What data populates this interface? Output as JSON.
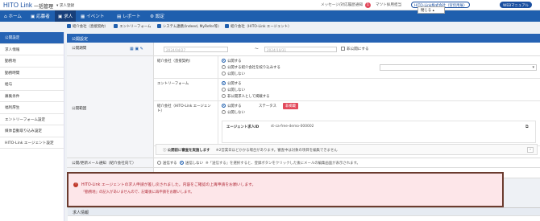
{
  "header": {
    "logo": "HITO Link",
    "app": "一括管理",
    "job": "▾ 求人登録",
    "message": "メッセージ/対応履歴",
    "notify": "通知",
    "notify_count": "1",
    "company": "マツト採用担当",
    "link1": "HITO-Link株式会社（宣伝用展）",
    "link2": "WEBマニュアル"
  },
  "nav": {
    "items": [
      "ホーム",
      "応募者",
      "求人",
      "イベント",
      "レポート",
      "設定"
    ],
    "active": "求人"
  },
  "tags": [
    "紹介会社（直接契約）",
    "エントリーフォーム",
    "システム連携(Indeed, MyRefer等)",
    "紹介会社（HITO-Link エージェント）"
  ],
  "sidebar": {
    "items": [
      "公開設定",
      "求人情報",
      "勤務地",
      "勤務時間",
      "給与",
      "募集条件",
      "福利厚生",
      "エントリーフォーム設定",
      "媒体自動取り込み設定",
      "HITO-Link エージェント設定"
    ]
  },
  "section": {
    "title": "公開設定"
  },
  "period": {
    "label": "公開期間",
    "start": "2024/04/27",
    "end": "2024/10/31",
    "sep": "〜",
    "checkbox": "非公開にする"
  },
  "scope": {
    "label": "公開範囲",
    "direct": {
      "label": "紹介会社（直接契約）",
      "options": [
        "公開する",
        "公開する紹介会社を絞り込みする",
        "公開しない"
      ]
    },
    "entry": {
      "label": "エントリーフォーム",
      "options": [
        "公開する",
        "公開しない",
        "非公開求人として掲載する"
      ]
    },
    "hito": {
      "label": "紹介会社（HITO-Link エージェント）",
      "options": [
        "公開する",
        "公開しない"
      ],
      "status_label": "ステータス",
      "status": "非掲載"
    },
    "agent_id_label": "エージェント求人ID",
    "agent_id": "st-ca-free-demo-000002",
    "notice": "公開前に審査を実施します",
    "notice_sub": "※2営業日ほどかかる場合があります。審査中は対象の項目を編集できません"
  },
  "mail": {
    "label": "公開/更新メール通知（紹介会社向て）",
    "opt1": "送信する",
    "opt2": "送信しない",
    "note": "※「送信する」を選択すると、登録ボタンをクリックした後にメールの編集画面が表示されます。"
  },
  "alert": {
    "title": "HITO-Link エージェントの求人申請が差し戻されました。内容をご確認の上再申請をお願いします。",
    "body": "「勤務地」の記入があいませんので、記載後に再申請をお願いします。",
    "close": "閉じる ▴"
  },
  "section2": {
    "title": "求人情報"
  }
}
